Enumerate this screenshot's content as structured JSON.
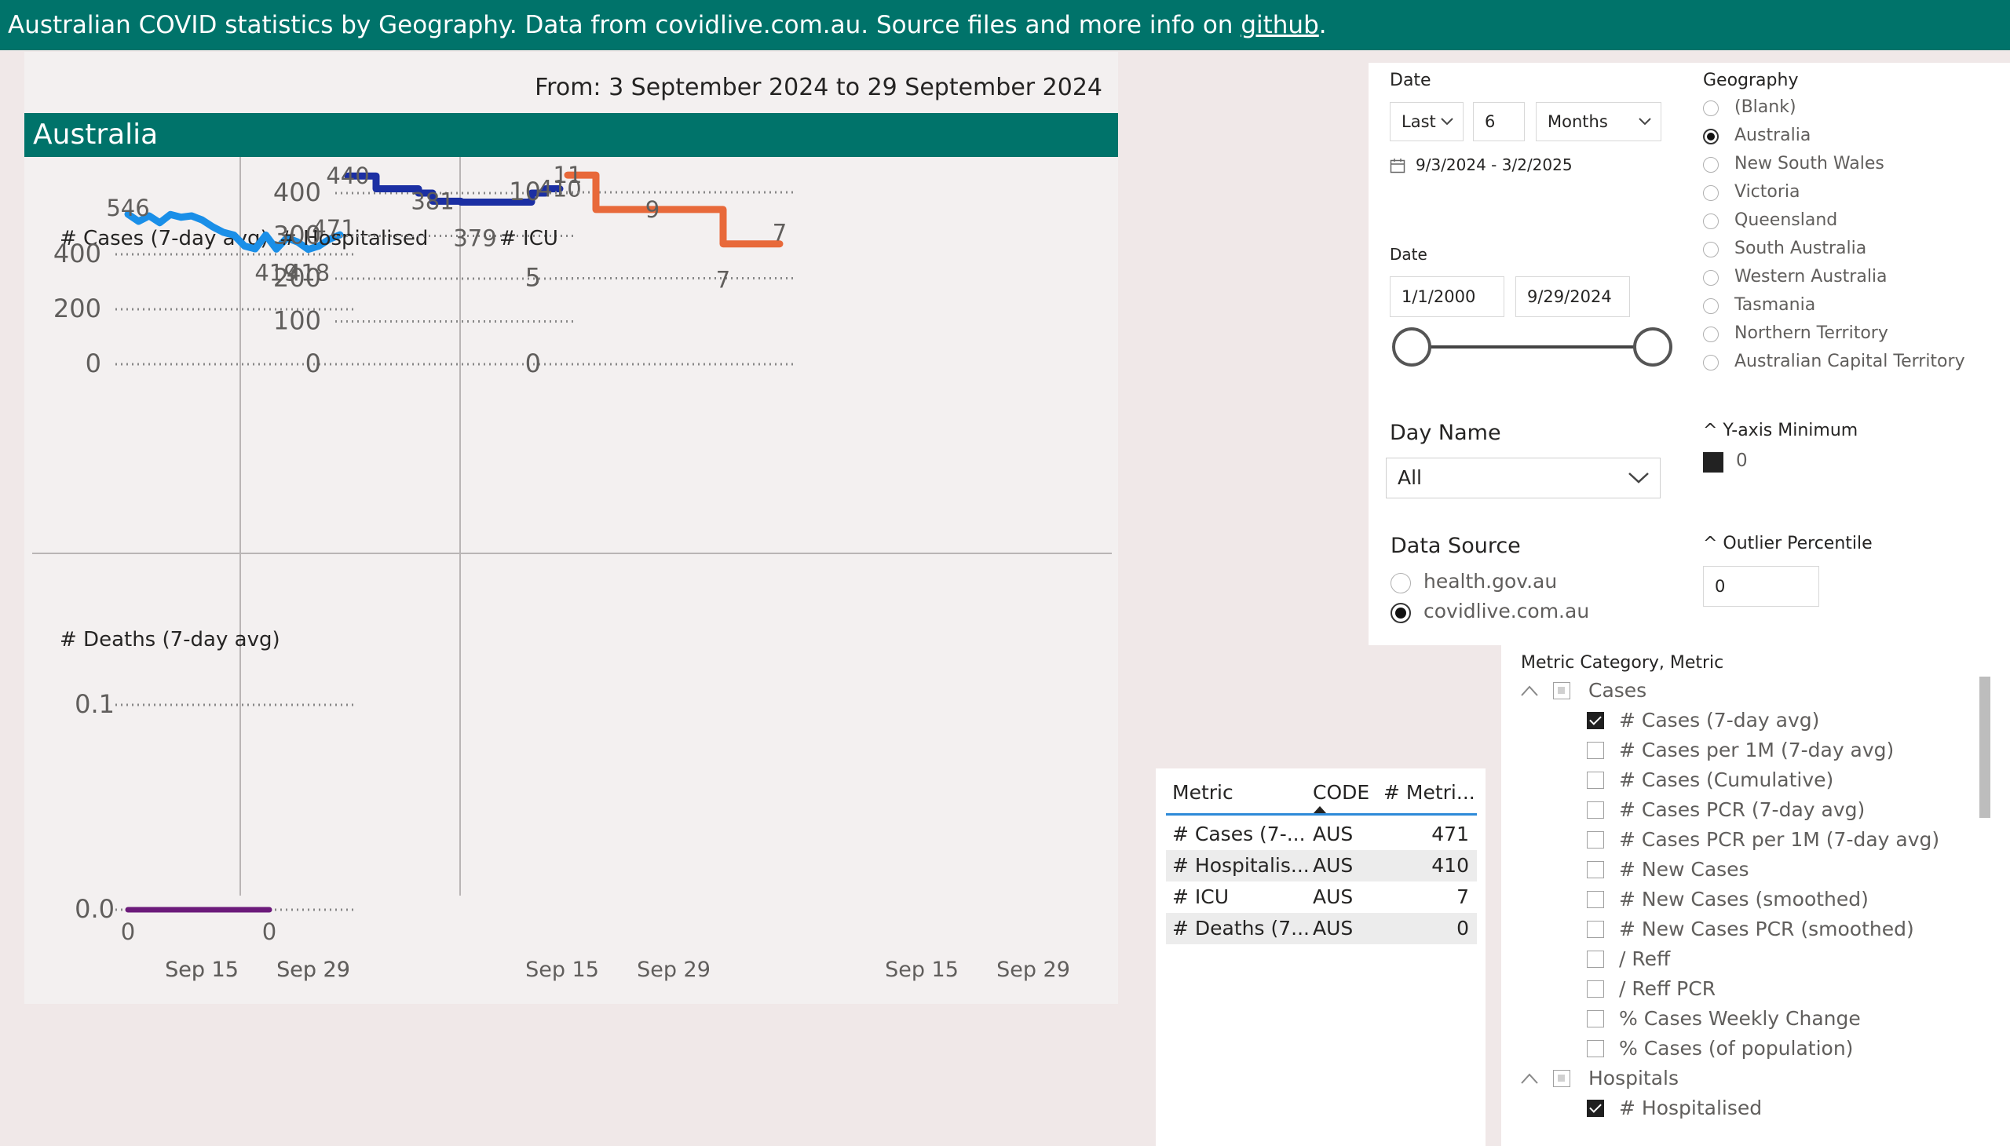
{
  "header": {
    "prefix": "Australian COVID statistics by Geography. Data from covidlive.com.au. Source files and more info on ",
    "link": "github",
    "suffix": "."
  },
  "panel": {
    "date_range": "From: 3 September 2024 to 29 September 2024",
    "geography": "Australia"
  },
  "colors": {
    "brand": "#00736a",
    "cases": "#1a8fe8",
    "hospitalised": "#1b2fa3",
    "icu": "#e8693a",
    "deaths": "#6b1a7a"
  },
  "chart_data": [
    {
      "type": "line",
      "title": "# Cases (7-day avg)",
      "x_ticks": [
        "Sep 15",
        "Sep 29"
      ],
      "y_ticks": [
        "400",
        "200",
        "0"
      ],
      "ylim": [
        0,
        550
      ],
      "series": [
        {
          "values": [
            546,
            520,
            540,
            515,
            545,
            535,
            540,
            525,
            500,
            480,
            470,
            430,
            420,
            470,
            419,
            460,
            445,
            418,
            430,
            455,
            471
          ]
        }
      ],
      "labels": [
        {
          "text": "546",
          "index": 0
        },
        {
          "text": "419",
          "index": 14
        },
        {
          "text": "418",
          "index": 17
        },
        {
          "text": "471",
          "index": 20
        }
      ]
    },
    {
      "type": "line",
      "title": "# Hospitalised",
      "x_ticks": [
        "Sep 15",
        "Sep 29"
      ],
      "y_ticks": [
        "400",
        "300",
        "200",
        "100",
        "0"
      ],
      "ylim": [
        0,
        420
      ],
      "series": [
        {
          "values": [
            440,
            440,
            410,
            410,
            410,
            400,
            381,
            381,
            379,
            379,
            379,
            379,
            379,
            400,
            410,
            410
          ]
        }
      ],
      "labels": [
        {
          "text": "440",
          "index": 0
        },
        {
          "text": "381",
          "index": 6
        },
        {
          "text": "379",
          "index": 9
        },
        {
          "text": "410",
          "index": 15
        }
      ]
    },
    {
      "type": "line",
      "title": "# ICU",
      "x_ticks": [
        "Sep 15",
        "Sep 29"
      ],
      "y_ticks": [
        "10",
        "5",
        "0"
      ],
      "ylim": [
        0,
        10.5
      ],
      "series": [
        {
          "values": [
            11,
            11,
            9,
            9,
            9,
            9,
            9,
            9,
            9,
            9,
            9,
            7,
            7,
            7,
            7,
            7
          ]
        }
      ],
      "labels": [
        {
          "text": "11",
          "index": 0
        },
        {
          "text": "9",
          "index": 6
        },
        {
          "text": "7",
          "index": 11
        },
        {
          "text": "7",
          "index": 15
        }
      ]
    },
    {
      "type": "line",
      "title": "# Deaths (7-day avg)",
      "x_ticks": [
        "Sep 15",
        "Sep 29"
      ],
      "y_ticks": [
        "0.1",
        "0.0"
      ],
      "ylim": [
        0,
        0.1
      ],
      "series": [
        {
          "values": [
            0,
            0,
            0,
            0
          ]
        }
      ],
      "labels": [
        {
          "text": "0",
          "index": 0
        },
        {
          "text": "0",
          "index": 3
        }
      ]
    }
  ],
  "slicers": {
    "relative_date": {
      "label": "Date",
      "mode": "Last",
      "count": "6",
      "unit": "Months",
      "range_text": "9/3/2024 - 3/2/2025"
    },
    "date_range": {
      "label": "Date",
      "start": "1/1/2000",
      "end": "9/29/2024"
    },
    "geography": {
      "label": "Geography",
      "options": [
        "(Blank)",
        "Australia",
        "New South Wales",
        "Victoria",
        "Queensland",
        "South Australia",
        "Western Australia",
        "Tasmania",
        "Northern Territory",
        "Australian Capital Territory"
      ],
      "selected": "Australia"
    },
    "day_name": {
      "label": "Day Name",
      "value": "All"
    },
    "y_axis_min": {
      "label": "^ Y-axis Minimum",
      "value": "0"
    },
    "data_source": {
      "label": "Data Source",
      "options": [
        "health.gov.au",
        "covidlive.com.au"
      ],
      "selected": "covidlive.com.au"
    },
    "outlier": {
      "label": "^ Outlier Percentile",
      "value": "0"
    }
  },
  "table": {
    "headers": [
      "Metric",
      "CODE",
      "# Metri..."
    ],
    "rows": [
      [
        "# Cases (7-...",
        "AUS",
        "471"
      ],
      [
        "# Hospitalis...",
        "AUS",
        "410"
      ],
      [
        "# ICU",
        "AUS",
        "7"
      ],
      [
        "# Deaths (7...",
        "AUS",
        "0"
      ]
    ]
  },
  "tree": {
    "title": "Metric Category, Metric",
    "categories": [
      {
        "name": "Cases",
        "items": [
          {
            "label": "# Cases (7-day avg)",
            "checked": true
          },
          {
            "label": "# Cases per 1M (7-day avg)",
            "checked": false
          },
          {
            "label": "# Cases (Cumulative)",
            "checked": false
          },
          {
            "label": "# Cases PCR (7-day avg)",
            "checked": false
          },
          {
            "label": "# Cases PCR per 1M (7-day avg)",
            "checked": false
          },
          {
            "label": "# New Cases",
            "checked": false
          },
          {
            "label": "# New Cases (smoothed)",
            "checked": false
          },
          {
            "label": "# New Cases PCR (smoothed)",
            "checked": false
          },
          {
            "label": "/ Reff",
            "checked": false
          },
          {
            "label": "/ Reff PCR",
            "checked": false
          },
          {
            "label": "% Cases Weekly Change",
            "checked": false
          },
          {
            "label": "% Cases (of population)",
            "checked": false
          }
        ]
      },
      {
        "name": "Hospitals",
        "items": [
          {
            "label": "# Hospitalised",
            "checked": true
          }
        ]
      }
    ]
  }
}
